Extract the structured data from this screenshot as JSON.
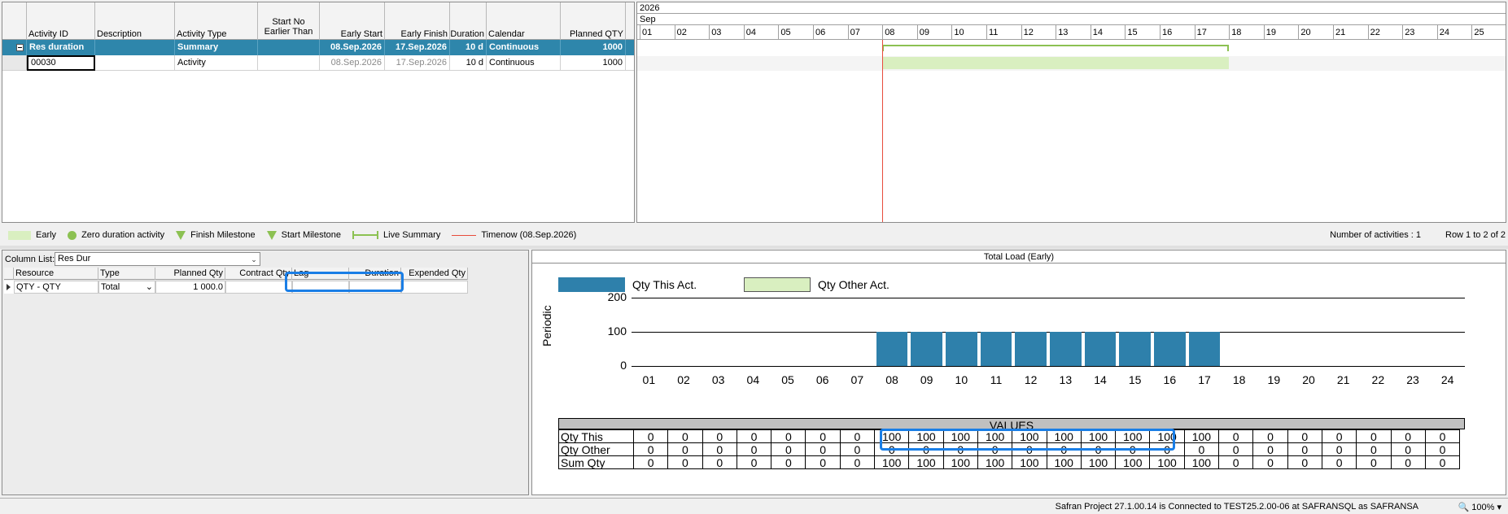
{
  "grid": {
    "columns": [
      {
        "key": "activity_id",
        "label": "Activity ID"
      },
      {
        "key": "description",
        "label": "Description"
      },
      {
        "key": "activity_type",
        "label": "Activity Type"
      },
      {
        "key": "start_no_earlier",
        "label": "Start No Earlier Than"
      },
      {
        "key": "early_start",
        "label": "Early Start"
      },
      {
        "key": "early_finish",
        "label": "Early Finish"
      },
      {
        "key": "duration",
        "label": "Duration"
      },
      {
        "key": "calendar",
        "label": "Calendar"
      },
      {
        "key": "planned_qty",
        "label": "Planned QTY"
      }
    ],
    "summary_row": {
      "activity_id": "Res duration",
      "description": "",
      "activity_type": "Summary",
      "start_no_earlier": "",
      "early_start": "08.Sep.2026",
      "early_finish": "17.Sep.2026",
      "duration": "10 d",
      "calendar": "Continuous",
      "planned_qty": "1000"
    },
    "activity_row": {
      "activity_id": "00030",
      "description": "",
      "activity_type": "Activity",
      "start_no_earlier": "",
      "early_start": "08.Sep.2026",
      "early_finish": "17.Sep.2026",
      "duration": "10 d",
      "calendar": "Continuous",
      "planned_qty": "1000"
    }
  },
  "gantt": {
    "year": "2026",
    "month": "Sep",
    "days": [
      "01",
      "02",
      "03",
      "04",
      "05",
      "06",
      "07",
      "08",
      "09",
      "10",
      "11",
      "12",
      "13",
      "14",
      "15",
      "16",
      "17",
      "18",
      "19",
      "20",
      "21",
      "22",
      "23",
      "24",
      "25"
    ],
    "bar_start_day": 8,
    "bar_end_day": 17,
    "timenow_day": 8
  },
  "legend": {
    "early": "Early",
    "zero_duration": "Zero duration activity",
    "finish_milestone": "Finish Milestone",
    "start_milestone": "Start Milestone",
    "live_summary": "Live Summary",
    "timenow": "Timenow (08.Sep.2026)",
    "activity_count": "Number of activities : 1",
    "row_range": "Row 1 to 2 of 2"
  },
  "resources": {
    "column_list_label": "Column List:",
    "column_list_value": "Res Dur",
    "columns": [
      "Resource",
      "Type",
      "Planned Qty",
      "Contract Qty",
      "Lag",
      "Duration",
      "Expended Qty"
    ],
    "row": {
      "resource": "QTY - QTY",
      "type": "Total",
      "planned_qty": "1 000.0",
      "contract_qty": "",
      "lag": "",
      "duration": "",
      "expended_qty": ""
    }
  },
  "chart_panel": {
    "title": "Total Load (Early)",
    "legend_this": "Qty This Act.",
    "legend_other": "Qty Other Act.",
    "ylabel": "Periodic",
    "values_header": "VALUES",
    "row_labels": [
      "Qty This",
      "Qty Other",
      "Sum Qty"
    ],
    "colors": {
      "this": "#2e80ab",
      "other": "#d9efc0"
    }
  },
  "chart_data": {
    "type": "bar",
    "categories": [
      "01",
      "02",
      "03",
      "04",
      "05",
      "06",
      "07",
      "08",
      "09",
      "10",
      "11",
      "12",
      "13",
      "14",
      "15",
      "16",
      "17",
      "18",
      "19",
      "20",
      "21",
      "22",
      "23",
      "24"
    ],
    "series": [
      {
        "name": "Qty This Act.",
        "values": [
          0,
          0,
          0,
          0,
          0,
          0,
          0,
          100,
          100,
          100,
          100,
          100,
          100,
          100,
          100,
          100,
          100,
          0,
          0,
          0,
          0,
          0,
          0,
          0
        ]
      },
      {
        "name": "Qty Other Act.",
        "values": [
          0,
          0,
          0,
          0,
          0,
          0,
          0,
          0,
          0,
          0,
          0,
          0,
          0,
          0,
          0,
          0,
          0,
          0,
          0,
          0,
          0,
          0,
          0,
          0
        ]
      }
    ],
    "sum": [
      0,
      0,
      0,
      0,
      0,
      0,
      0,
      100,
      100,
      100,
      100,
      100,
      100,
      100,
      100,
      100,
      100,
      0,
      0,
      0,
      0,
      0,
      0,
      0
    ],
    "ylabel": "Periodic",
    "yticks": [
      0,
      100,
      200
    ],
    "ylim": [
      0,
      200
    ]
  },
  "status": {
    "connection": "Safran Project 27.1.00.14 is Connected to TEST25.2.00-06 at SAFRANSQL as SAFRANSA",
    "zoom": "100%"
  }
}
